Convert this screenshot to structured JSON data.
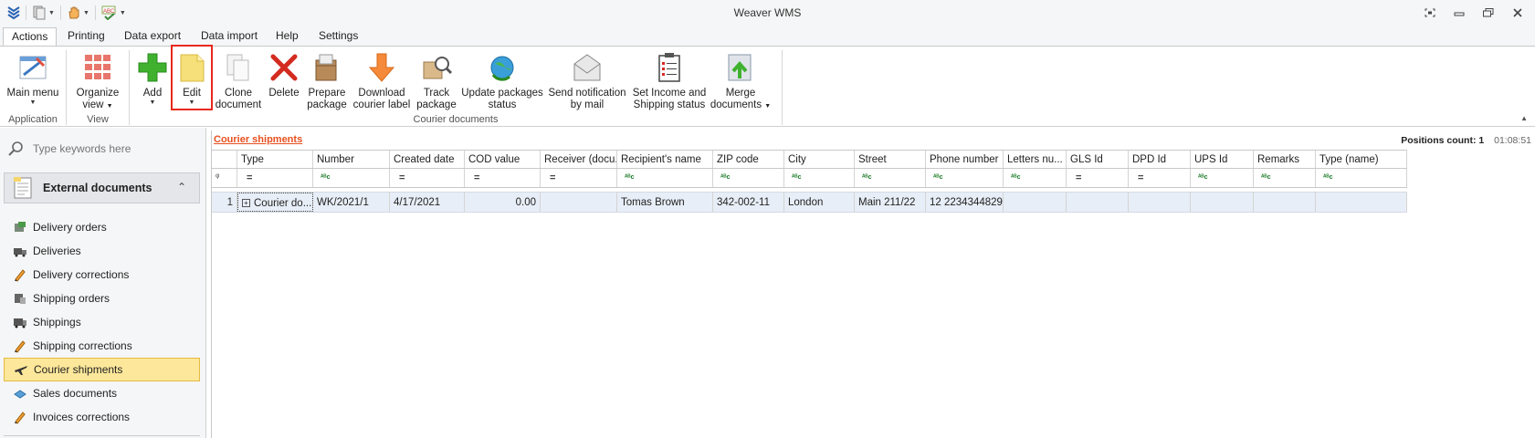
{
  "window": {
    "title": "Weaver WMS"
  },
  "tabs": [
    "Actions",
    "Printing",
    "Data export",
    "Data import",
    "Help",
    "Settings"
  ],
  "ribbon": {
    "groups": {
      "application": {
        "label": "Application",
        "buttons": [
          {
            "label": "Main menu",
            "icon": "main-menu-icon"
          }
        ]
      },
      "view": {
        "label": "View",
        "buttons": [
          {
            "label": "Organize view",
            "icon": "organize-view-icon"
          }
        ]
      },
      "courier_documents": {
        "label": "Courier documents",
        "buttons": [
          {
            "label": "Add",
            "icon": "add-icon"
          },
          {
            "label": "Edit",
            "icon": "edit-icon"
          },
          {
            "label": "Clone document",
            "icon": "clone-icon"
          },
          {
            "label": "Delete",
            "icon": "delete-icon"
          },
          {
            "label": "Prepare package",
            "icon": "prepare-package-icon"
          },
          {
            "label": "Download courier label",
            "icon": "download-icon"
          },
          {
            "label": "Track package",
            "icon": "track-package-icon"
          },
          {
            "label": "Update packages status",
            "icon": "update-status-icon"
          },
          {
            "label": "Send notification by mail",
            "icon": "mail-icon"
          },
          {
            "label": "Set Income and Shipping status",
            "icon": "clipboard-icon"
          },
          {
            "label": "Merge documents",
            "icon": "merge-icon"
          }
        ]
      }
    }
  },
  "search": {
    "placeholder": "Type keywords here"
  },
  "nav": {
    "section": "External documents",
    "items": [
      {
        "label": "Delivery orders"
      },
      {
        "label": "Deliveries"
      },
      {
        "label": "Delivery corrections"
      },
      {
        "label": "Shipping orders"
      },
      {
        "label": "Shippings"
      },
      {
        "label": "Shipping corrections"
      },
      {
        "label": "Courier shipments"
      },
      {
        "label": "Sales documents"
      },
      {
        "label": "Invoices corrections"
      }
    ],
    "active_item": "Courier shipments"
  },
  "grid": {
    "title": "Courier shipments",
    "positions_label": "Positions count:",
    "positions_count": "1",
    "time": "01:08:51",
    "columns": [
      "Type",
      "Number",
      "Created date",
      "COD value",
      "Receiver (docu...",
      "Recipient's name",
      "ZIP code",
      "City",
      "Street",
      "Phone number",
      "Letters nu...",
      "GLS Id",
      "DPD Id",
      "UPS Id",
      "Remarks",
      "Type (name)"
    ],
    "filter_types": [
      "eq",
      "abc",
      "eq",
      "eq",
      "eq",
      "abc",
      "abc",
      "abc",
      "abc",
      "abc",
      "abc",
      "eq",
      "eq",
      "abc",
      "abc",
      "abc"
    ],
    "rows": [
      {
        "num": "1",
        "cells": [
          "Courier do...",
          "WK/2021/1",
          "4/17/2021",
          "0.00",
          "",
          "Tomas Brown",
          "342-002-11",
          "London",
          "Main 211/22",
          "12 2234344829",
          "",
          "",
          "",
          "",
          "",
          ""
        ]
      }
    ]
  },
  "colors": {
    "accent_orange": "#e8501e",
    "active_nav": "#fde79a",
    "row_selected": "#e8eef7"
  }
}
